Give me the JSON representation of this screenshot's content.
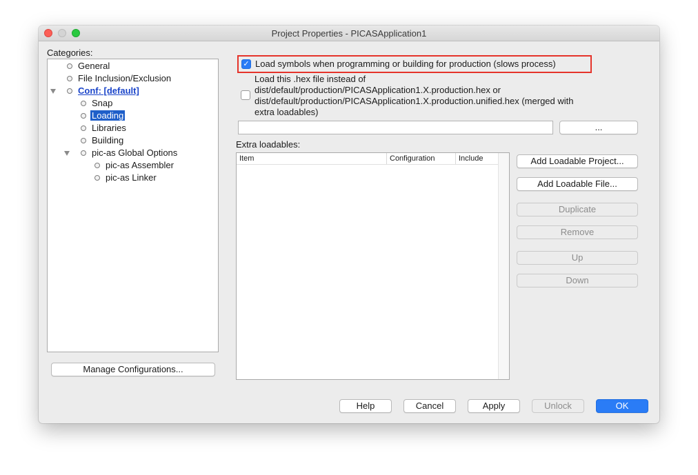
{
  "window": {
    "title": "Project Properties - PICASApplication1"
  },
  "categories": {
    "label": "Categories:",
    "items": [
      {
        "label": "General"
      },
      {
        "label": "File Inclusion/Exclusion"
      },
      {
        "label": "Conf: [default]"
      },
      {
        "label": "Snap"
      },
      {
        "label": "Loading"
      },
      {
        "label": "Libraries"
      },
      {
        "label": "Building"
      },
      {
        "label": "pic-as Global Options"
      },
      {
        "label": "pic-as Assembler"
      },
      {
        "label": "pic-as Linker"
      }
    ],
    "selected": "Loading"
  },
  "manage_configurations_label": "Manage Configurations...",
  "loading": {
    "load_symbols_label": "Load symbols when programming or building for production (slows process)",
    "load_symbols_checked": true,
    "hex_instead_lines": [
      "Load this .hex file instead of",
      "dist/default/production/PICASApplication1.X.production.hex or",
      "dist/default/production/PICASApplication1.X.production.unified.hex (merged with",
      "extra loadables)"
    ],
    "hex_instead_checked": false,
    "hex_file_value": "",
    "browse_label": "...",
    "extra_loadables_label": "Extra loadables:",
    "table_columns": [
      "Item",
      "Configuration",
      "Include"
    ],
    "table_rows": []
  },
  "side_buttons": {
    "add_project": "Add Loadable Project...",
    "add_file": "Add Loadable File...",
    "duplicate": "Duplicate",
    "remove": "Remove",
    "up": "Up",
    "down": "Down"
  },
  "footer": {
    "help": "Help",
    "cancel": "Cancel",
    "apply": "Apply",
    "unlock": "Unlock",
    "ok": "OK"
  },
  "colors": {
    "accent": "#2a7cf6",
    "selection": "#1f5fc9",
    "highlight_border": "#e5332a",
    "link": "#1a44c9"
  }
}
